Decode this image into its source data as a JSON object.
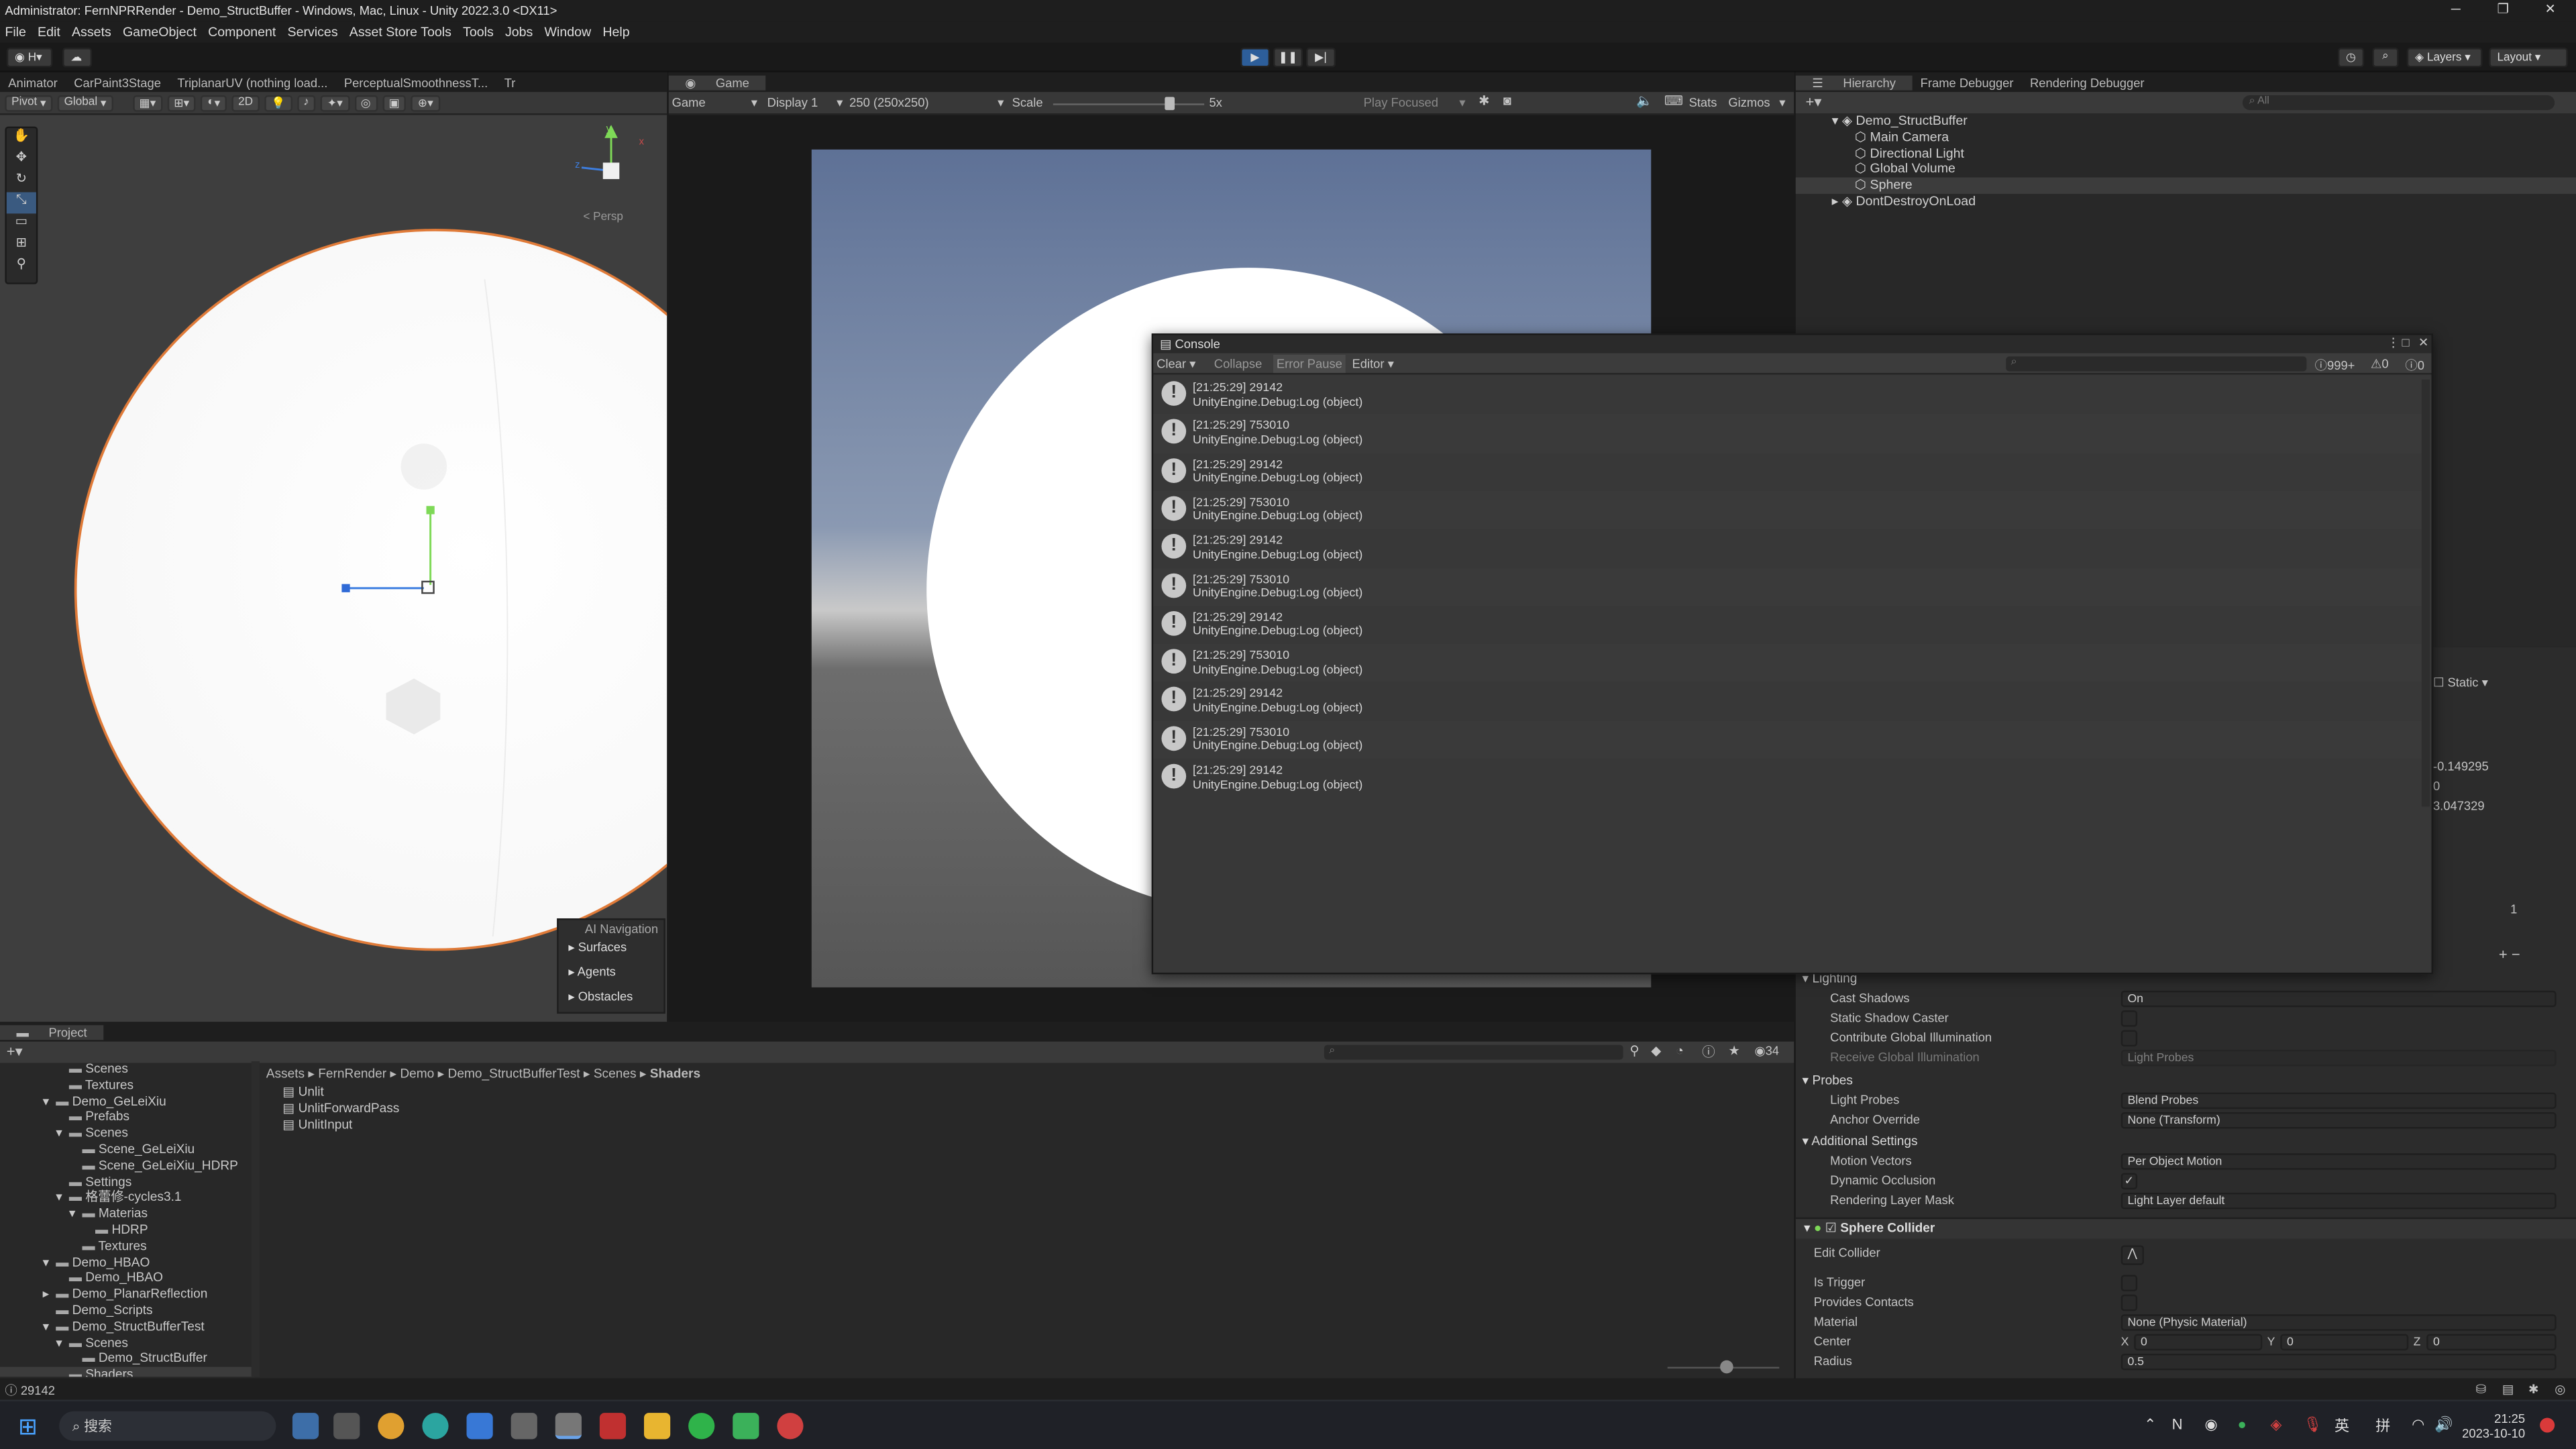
{
  "window": {
    "title": "Administrator: FernNPRRender - Demo_StructBuffer - Windows, Mac, Linux - Unity 2022.3.0 <DX11>"
  },
  "menu": [
    "File",
    "Edit",
    "Assets",
    "GameObject",
    "Component",
    "Services",
    "Asset Store Tools",
    "Tools",
    "Jobs",
    "Window",
    "Help"
  ],
  "toolbar": {
    "account": "H",
    "layers": "Layers",
    "layout": "Layout"
  },
  "scene": {
    "tabs": [
      "Animator",
      "CarPaint3Stage",
      "TriplanarUV (nothing load...",
      "PerceptualSmoothnessT...",
      "Tr"
    ],
    "pivot": "Pivot",
    "global": "Global",
    "mode_2d": "2D",
    "persp": "< Persp",
    "ai_nav": {
      "title": "AI Navigation",
      "items": [
        "Surfaces",
        "Agents",
        "Obstacles"
      ]
    }
  },
  "game": {
    "tab": "Game",
    "mode": "Game",
    "display": "Display 1",
    "res": "250 (250x250)",
    "scale_label": "Scale",
    "scale_value": "5x",
    "play_focused": "Play Focused",
    "stats": "Stats",
    "gizmos": "Gizmos"
  },
  "hierarchy": {
    "tabs": [
      "Hierarchy",
      "Frame Debugger",
      "Rendering Debugger"
    ],
    "search_placeholder": "All",
    "root": "Demo_StructBuffer",
    "children": [
      "Main Camera",
      "Directional Light",
      "Global Volume",
      "Sphere"
    ],
    "dontdestroy": "DontDestroyOnLoad"
  },
  "inspector": {
    "static": "Static",
    "partial_values": [
      "-0.149295",
      "0",
      "3.047329",
      "1"
    ],
    "lighting": {
      "title": "Lighting",
      "rows": [
        {
          "label": "Cast Shadows",
          "value": "On"
        },
        {
          "label": "Static Shadow Caster",
          "value": ""
        },
        {
          "label": "Contribute Global Illumination",
          "value": ""
        },
        {
          "label": "Receive Global Illumination",
          "value": "Light Probes"
        }
      ]
    },
    "probes": {
      "title": "Probes",
      "rows": [
        {
          "label": "Light Probes",
          "value": "Blend Probes"
        },
        {
          "label": "Anchor Override",
          "value": "None (Transform)"
        }
      ]
    },
    "additional": {
      "title": "Additional Settings",
      "rows": [
        {
          "label": "Motion Vectors",
          "value": "Per Object Motion"
        },
        {
          "label": "Dynamic Occlusion",
          "value": "✓"
        },
        {
          "label": "Rendering Layer Mask",
          "value": "Light Layer default"
        }
      ]
    },
    "collider": {
      "title": "Sphere Collider",
      "rows": [
        {
          "label": "Edit Collider",
          "value": ""
        },
        {
          "label": "Is Trigger",
          "value": ""
        },
        {
          "label": "Provides Contacts",
          "value": ""
        },
        {
          "label": "Material",
          "value": "None (Physic Material)"
        }
      ],
      "center_label": "Center",
      "cx": "0",
      "cy": "0",
      "cz": "0",
      "radius_label": "Radius",
      "radius": "0.5"
    }
  },
  "console": {
    "title": "Console",
    "clear": "Clear",
    "collapse": "Collapse",
    "error_pause": "Error Pause",
    "editor": "Editor",
    "count_log": "999+",
    "count_warn": "0",
    "count_err": "0",
    "entries": [
      {
        "time": "[21:25:29] 29142",
        "msg": "UnityEngine.Debug:Log (object)"
      },
      {
        "time": "[21:25:29] 753010",
        "msg": "UnityEngine.Debug:Log (object)"
      },
      {
        "time": "[21:25:29] 29142",
        "msg": "UnityEngine.Debug:Log (object)"
      },
      {
        "time": "[21:25:29] 753010",
        "msg": "UnityEngine.Debug:Log (object)"
      },
      {
        "time": "[21:25:29] 29142",
        "msg": "UnityEngine.Debug:Log (object)"
      },
      {
        "time": "[21:25:29] 753010",
        "msg": "UnityEngine.Debug:Log (object)"
      },
      {
        "time": "[21:25:29] 29142",
        "msg": "UnityEngine.Debug:Log (object)"
      },
      {
        "time": "[21:25:29] 753010",
        "msg": "UnityEngine.Debug:Log (object)"
      },
      {
        "time": "[21:25:29] 29142",
        "msg": "UnityEngine.Debug:Log (object)"
      },
      {
        "time": "[21:25:29] 753010",
        "msg": "UnityEngine.Debug:Log (object)"
      },
      {
        "time": "[21:25:29] 29142",
        "msg": "UnityEngine.Debug:Log (object)"
      }
    ]
  },
  "project": {
    "tab": "Project",
    "badge": "34",
    "tree": [
      {
        "label": "Scenes",
        "indent": 3,
        "fold": ""
      },
      {
        "label": "Textures",
        "indent": 3,
        "fold": ""
      },
      {
        "label": "Demo_GeLeiXiu",
        "indent": 2,
        "fold": "▾"
      },
      {
        "label": "Prefabs",
        "indent": 3,
        "fold": ""
      },
      {
        "label": "Scenes",
        "indent": 3,
        "fold": "▾"
      },
      {
        "label": "Scene_GeLeiXiu",
        "indent": 4,
        "fold": ""
      },
      {
        "label": "Scene_GeLeiXiu_HDRP",
        "indent": 4,
        "fold": ""
      },
      {
        "label": "Settings",
        "indent": 3,
        "fold": ""
      },
      {
        "label": "格蕾修-cycles3.1",
        "indent": 3,
        "fold": "▾"
      },
      {
        "label": "Materias",
        "indent": 4,
        "fold": "▾"
      },
      {
        "label": "HDRP",
        "indent": 5,
        "fold": ""
      },
      {
        "label": "Textures",
        "indent": 4,
        "fold": ""
      },
      {
        "label": "Demo_HBAO",
        "indent": 2,
        "fold": "▾"
      },
      {
        "label": "Demo_HBAO",
        "indent": 3,
        "fold": ""
      },
      {
        "label": "Demo_PlanarReflection",
        "indent": 2,
        "fold": "▸"
      },
      {
        "label": "Demo_Scripts",
        "indent": 2,
        "fold": ""
      },
      {
        "label": "Demo_StructBufferTest",
        "indent": 2,
        "fold": "▾"
      },
      {
        "label": "Scenes",
        "indent": 3,
        "fold": "▾"
      },
      {
        "label": "Demo_StructBuffer",
        "indent": 4,
        "fold": ""
      },
      {
        "label": "Shaders",
        "indent": 3,
        "fold": ""
      }
    ],
    "breadcrumb": [
      "Assets",
      "FernRender",
      "Demo",
      "Demo_StructBufferTest",
      "Scenes",
      "Shaders"
    ],
    "files": [
      "Unlit",
      "UnlitForwardPass",
      "UnlitInput"
    ]
  },
  "status": {
    "text": "29142"
  },
  "taskbar": {
    "search": "搜索",
    "ime1": "英",
    "ime2": "拼",
    "time": "21:25",
    "date": "2023-10-10"
  }
}
